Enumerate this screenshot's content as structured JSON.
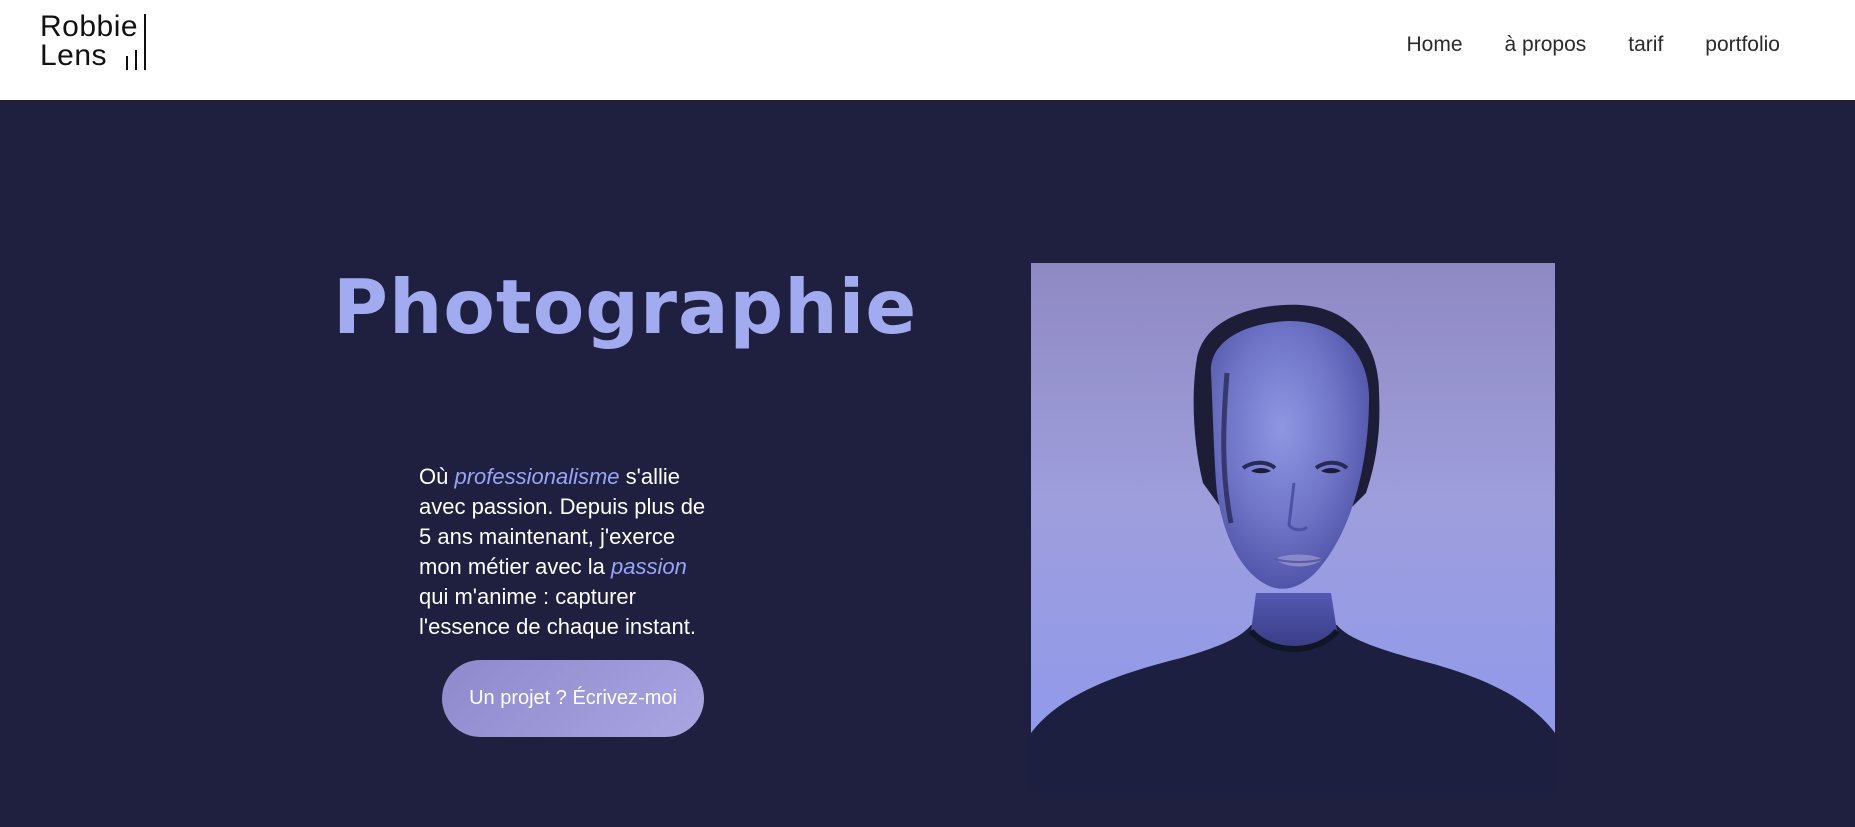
{
  "brand": {
    "line1": "Robbie",
    "line2": "Lens"
  },
  "nav": {
    "items": [
      {
        "label": "Home"
      },
      {
        "label": "à propos"
      },
      {
        "label": "tarif"
      },
      {
        "label": "portfolio"
      }
    ]
  },
  "hero": {
    "title": "Photographie",
    "description": {
      "part1": "Où ",
      "highlight1": "professionalisme",
      "part2": " s'allie avec passion. Depuis plus de 5 ans maintenant, j'exerce mon métier avec la ",
      "highlight2": "passion",
      "part3": " qui m'anime : capturer l'essence de chaque instant."
    },
    "cta_label": "Un projet ? Écrivez-moi"
  },
  "colors": {
    "hero_background": "#1f2040",
    "accent": "#a3abf0",
    "cta_background": "#9d99d8"
  }
}
